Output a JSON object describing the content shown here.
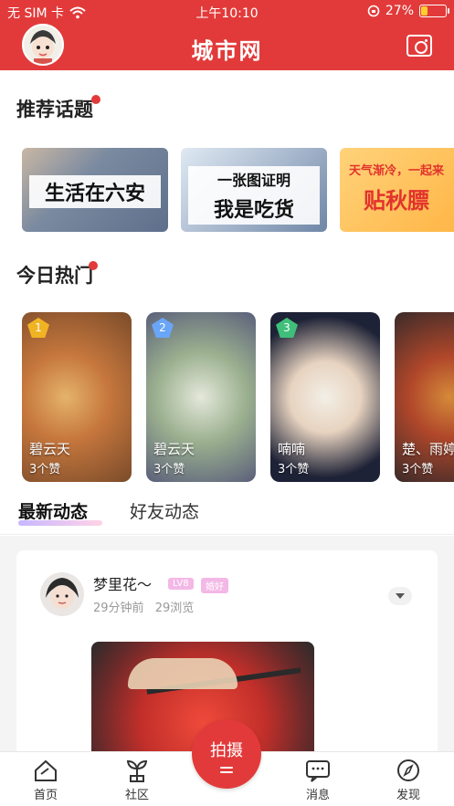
{
  "status_bar": {
    "carrier": "无 SIM 卡",
    "time": "上午10:10",
    "battery": "27%",
    "battery_level": 0.27
  },
  "header": {
    "logo": "城市网",
    "camera_icon": "camera-icon",
    "avatar_icon": "user-avatar"
  },
  "sections": {
    "topics_title": "推荐话题",
    "hot_title": "今日热门"
  },
  "topics": [
    {
      "label": "生活在六安"
    },
    {
      "label_small": "一张图证明",
      "label_big": "我是吃货"
    },
    {
      "label_small": "天气渐冷，一起来",
      "label_big": "贴秋膘"
    }
  ],
  "hot": [
    {
      "rank": "1",
      "name": "碧云天",
      "likes": "3个赞",
      "rank_color": "#f0b323"
    },
    {
      "rank": "2",
      "name": "碧云天",
      "likes": "3个赞",
      "rank_color": "#6aa6f7"
    },
    {
      "rank": "3",
      "name": "喃喃",
      "likes": "3个赞",
      "rank_color": "#3fbf7a"
    },
    {
      "rank": "",
      "name": "楚、雨婷",
      "likes": "3个赞",
      "rank_color": "#999999"
    }
  ],
  "tabs": {
    "active": "最新动态",
    "inactive": "好友动态"
  },
  "post": {
    "author": "梦里花～",
    "level": "LV8",
    "tag": "婚好",
    "time": "29分钟前",
    "views": "29浏览"
  },
  "nav": {
    "home": "首页",
    "community": "社区",
    "shoot": "拍摄",
    "messages": "消息",
    "discover": "发现"
  },
  "colors": {
    "brand_red": "#e23a3a",
    "tab_gradient_start": "#c7b7ff",
    "tab_gradient_end": "#ffd3e6",
    "badge_pink": "#f3b8e6"
  }
}
